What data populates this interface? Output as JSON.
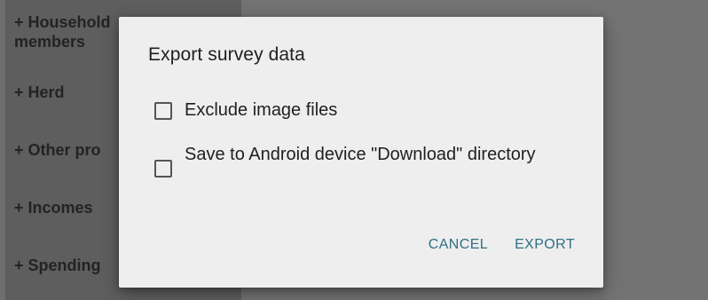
{
  "background": {
    "sidebar": {
      "items": [
        {
          "label": "+ Household\nmembers"
        },
        {
          "label": "+ Herd"
        },
        {
          "label": "+ Other pro"
        },
        {
          "label": "+ Incomes"
        },
        {
          "label": "+ Spending"
        }
      ]
    }
  },
  "dialog": {
    "title": "Export survey data",
    "options": [
      {
        "label": "Exclude image files",
        "checked": false
      },
      {
        "label": "Save to Android device \"Download\" directory",
        "checked": false
      }
    ],
    "actions": {
      "cancel": "CANCEL",
      "export": "EXPORT"
    }
  },
  "colors": {
    "accent": "#2f6f84",
    "dialog_bg": "#eeeeee",
    "scrim": "#6e6e6e"
  }
}
